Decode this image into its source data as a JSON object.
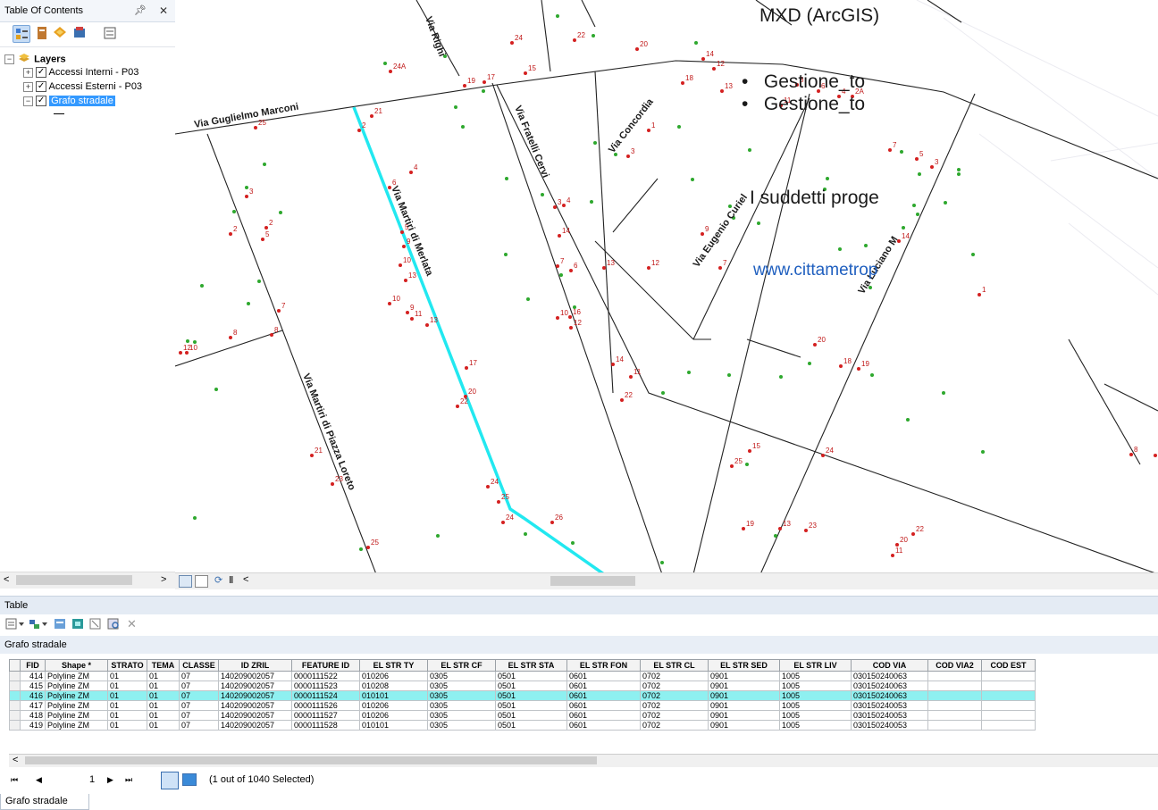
{
  "toc": {
    "title": "Table Of Contents",
    "pin": "ℂ",
    "close": "✕",
    "layers_label": "Layers",
    "items": [
      {
        "label": "Accessi Interni - P03"
      },
      {
        "label": "Accessi Esterni - P03"
      },
      {
        "label": "Grafo stradale"
      }
    ]
  },
  "map": {
    "streets": [
      {
        "label": "Via Righi"
      },
      {
        "label": "Via Guglielmo Marconi"
      },
      {
        "label": "Via Fratelli Cervi"
      },
      {
        "label": "Via Concordia"
      },
      {
        "label": "Via Martiri di Merlata"
      },
      {
        "label": "Via Eugenio Curiel"
      },
      {
        "label": "Via Luciano M"
      },
      {
        "label": "Via Martiri di Piazza Loreto"
      }
    ],
    "point_labels": [
      "24",
      "22",
      "20",
      "24A",
      "15",
      "18",
      "14",
      "12",
      "19",
      "17",
      "8",
      "6",
      "4",
      "2A",
      "13",
      "11",
      "25",
      "21",
      "2",
      "1",
      "3",
      "7",
      "5",
      "3",
      "2",
      "4",
      "3",
      "5",
      "6",
      "4",
      "3",
      "5",
      "2",
      "7",
      "8",
      "10",
      "12",
      "9",
      "10",
      "13",
      "6",
      "9",
      "14",
      "7",
      "9",
      "11",
      "8",
      "16",
      "10",
      "12",
      "14",
      "13",
      "17",
      "11",
      "20",
      "18",
      "22",
      "19",
      "20",
      "21",
      "23",
      "22",
      "24",
      "25",
      "24",
      "26",
      "15",
      "25",
      "24",
      "19",
      "13",
      "23",
      "25",
      "20",
      "22",
      "11",
      "1",
      "8",
      "9",
      "7",
      "14",
      "12",
      "13",
      "10"
    ]
  },
  "slide_overlay": {
    "line1": "MXD (ArcGIS)",
    "bullet1": "Gestione_to",
    "bullet2": "Gestione_to",
    "line2": "I suddetti proge",
    "link": "www.cittametrop"
  },
  "table_panel": {
    "title": "Table",
    "layer_name": "Grafo stradale",
    "columns": [
      "FID",
      "Shape *",
      "STRATO",
      "TEMA",
      "CLASSE",
      "ID ZRIL",
      "FEATURE ID",
      "EL STR TY",
      "EL STR CF",
      "EL STR STA",
      "EL STR FON",
      "EL STR CL",
      "EL STR SED",
      "EL STR LIV",
      "COD VIA",
      "COD VIA2",
      "COD EST"
    ],
    "rows": [
      [
        "414",
        "Polyline ZM",
        "01",
        "01",
        "07",
        "140209002057",
        "0000111522",
        "010206",
        "0305",
        "0501",
        "0601",
        "0702",
        "0901",
        "1005",
        "030150240063",
        "",
        ""
      ],
      [
        "415",
        "Polyline ZM",
        "01",
        "01",
        "07",
        "140209002057",
        "0000111523",
        "010208",
        "0305",
        "0501",
        "0601",
        "0702",
        "0901",
        "1005",
        "030150240063",
        "",
        ""
      ],
      [
        "416",
        "Polyline ZM",
        "01",
        "01",
        "07",
        "140209002057",
        "0000111524",
        "010101",
        "0305",
        "0501",
        "0601",
        "0702",
        "0901",
        "1005",
        "030150240063",
        "",
        ""
      ],
      [
        "417",
        "Polyline ZM",
        "01",
        "01",
        "07",
        "140209002057",
        "0000111526",
        "010206",
        "0305",
        "0501",
        "0601",
        "0702",
        "0901",
        "1005",
        "030150240053",
        "",
        ""
      ],
      [
        "418",
        "Polyline ZM",
        "01",
        "01",
        "07",
        "140209002057",
        "0000111527",
        "010206",
        "0305",
        "0501",
        "0601",
        "0702",
        "0901",
        "1005",
        "030150240053",
        "",
        ""
      ],
      [
        "419",
        "Polyline ZM",
        "01",
        "01",
        "07",
        "140209002057",
        "0000111528",
        "010101",
        "0305",
        "0501",
        "0601",
        "0702",
        "0901",
        "1005",
        "030150240053",
        "",
        ""
      ]
    ],
    "selected_fid": "416",
    "nav": {
      "first": "⏮",
      "prev": "◀",
      "current": "1",
      "next": "▶",
      "last": "⏭",
      "status": "(1 out of 1040 Selected)"
    },
    "footer_tab": "Grafo stradale"
  },
  "colors": {
    "selected_row": "#8ef0f0",
    "selected_line": "#22e8f0",
    "point_red": "#d42020",
    "point_green": "#2ea82e",
    "accent": "#3399ff"
  }
}
